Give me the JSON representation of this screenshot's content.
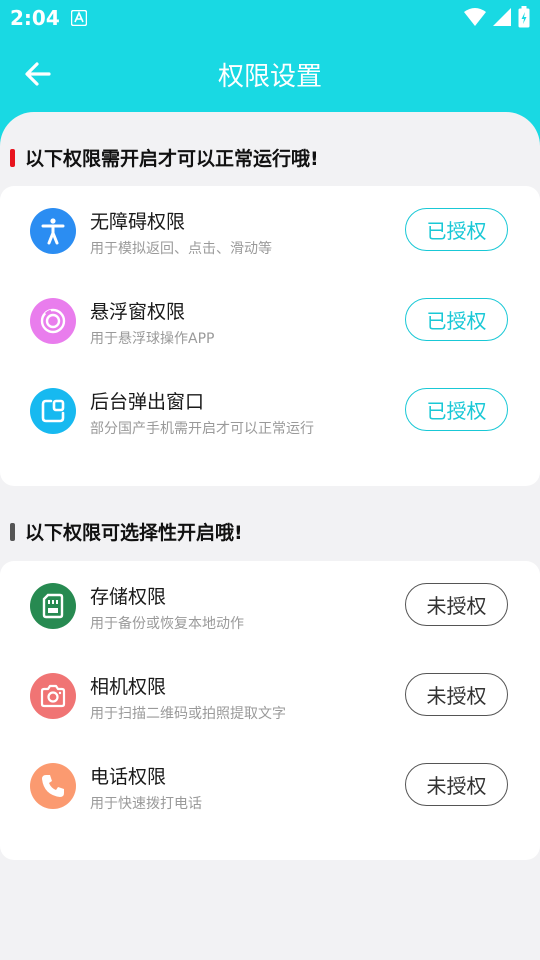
{
  "status_bar": {
    "time": "2:04"
  },
  "header": {
    "title": "权限设置"
  },
  "colors": {
    "accent": "#19d9e3",
    "granted": "#19c8d6",
    "section_required": "#e8141e",
    "section_optional": "#555555"
  },
  "required_section": {
    "title": "以下权限需开启才可以正常运行哦!",
    "items": [
      {
        "name": "无障碍权限",
        "desc": "用于模拟返回、点击、滑动等",
        "status": "已授权",
        "icon": "accessibility-icon",
        "color": "#2b8df2"
      },
      {
        "name": "悬浮窗权限",
        "desc": "用于悬浮球操作APP",
        "status": "已授权",
        "icon": "floating-window-icon",
        "color": "#e97ded"
      },
      {
        "name": "后台弹出窗口",
        "desc": "部分国产手机需开启才可以正常运行",
        "status": "已授权",
        "icon": "popup-window-icon",
        "color": "#17b9f0"
      }
    ]
  },
  "optional_section": {
    "title": "以下权限可选择性开启哦!",
    "items": [
      {
        "name": "存储权限",
        "desc": "用于备份或恢复本地动作",
        "status": "未授权",
        "icon": "storage-icon",
        "color": "#278a51"
      },
      {
        "name": "相机权限",
        "desc": "用于扫描二维码或拍照提取文字",
        "status": "未授权",
        "icon": "camera-icon",
        "color": "#f07474"
      },
      {
        "name": "电话权限",
        "desc": "用于快速拨打电话",
        "status": "未授权",
        "icon": "phone-icon",
        "color": "#fb9a70"
      }
    ]
  }
}
